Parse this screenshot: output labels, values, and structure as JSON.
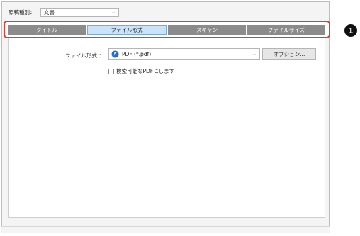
{
  "document_type": {
    "label": "原稿種別：",
    "value": "文書"
  },
  "tabs": [
    {
      "label": "タイトル",
      "active": false
    },
    {
      "label": "ファイル形式",
      "active": true
    },
    {
      "label": "スキャン",
      "active": false
    },
    {
      "label": "ファイルサイズ",
      "active": false
    }
  ],
  "file_format": {
    "label": "ファイル形式 ：",
    "value": "PDF (*.pdf)",
    "options_button": "オプション..."
  },
  "searchable_pdf": {
    "label": "検索可能なPDFにします",
    "checked": false
  },
  "callout": "1",
  "colors": {
    "active_tab": "#cbe3fa",
    "inactive_tab": "#8b8b8b",
    "highlight": "#e53935",
    "pdf_icon": "#1e6fd0"
  }
}
